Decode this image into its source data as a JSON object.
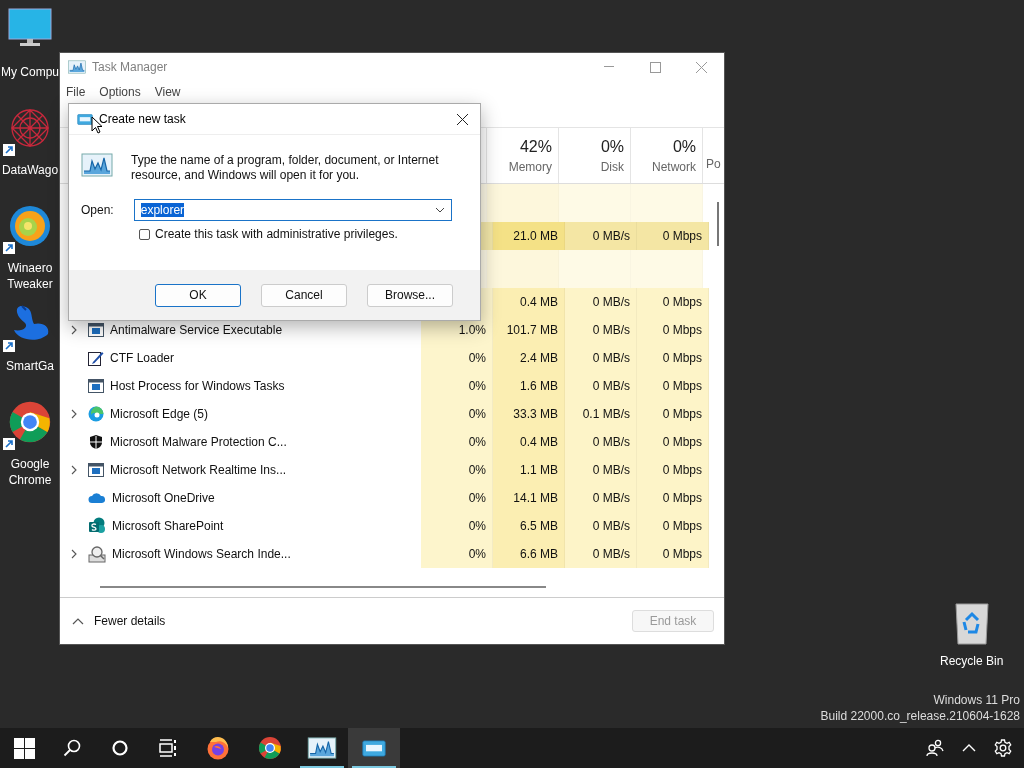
{
  "desktop": {
    "icons": [
      {
        "label": "My Compu",
        "kind": "monitor",
        "shortcut": false
      },
      {
        "label": "DataWago",
        "kind": "web",
        "shortcut": true
      },
      {
        "label": "Winaero Tweaker",
        "kind": "swirl",
        "shortcut": true
      },
      {
        "label": "SmartGa",
        "kind": "bird",
        "shortcut": true
      },
      {
        "label": "Google Chrome",
        "kind": "chrome",
        "shortcut": true
      }
    ],
    "recycle_bin": {
      "label": "Recycle Bin"
    },
    "edition": "Windows 11 Pro",
    "build": "Build 22000.co_release.210604-1628"
  },
  "task_manager": {
    "title": "Task Manager",
    "active": false,
    "menu": [
      "File",
      "Options",
      "View"
    ],
    "columns": [
      {
        "color": "#fdf5cc"
      },
      {
        "percent": "42%",
        "label": "Memory",
        "color": "#fbeeb2"
      },
      {
        "percent": "0%",
        "label": "Disk",
        "color": "#fdf4c8"
      },
      {
        "percent": "0%",
        "label": "Network",
        "color": "#fdf4c8"
      },
      {
        "label": "Po"
      }
    ],
    "rows": [
      {
        "kind": "group"
      },
      {
        "kind": "partial",
        "highlight": true,
        "memory": "21.0 MB",
        "disk": "0 MB/s",
        "network": "0 Mbps"
      },
      {
        "kind": "group"
      },
      {
        "kind": "partial",
        "highlight": false,
        "memory": "0.4 MB",
        "disk": "0 MB/s",
        "network": "0 Mbps"
      },
      {
        "kind": "app",
        "highlight": false,
        "name": "Antimalware Service Executable",
        "expandable": true,
        "cpu": "1.0%",
        "memory": "101.7 MB",
        "disk": "0 MB/s",
        "network": "0 Mbps"
      },
      {
        "kind": "pen",
        "highlight": false,
        "name": "CTF Loader",
        "expandable": false,
        "cpu": "0%",
        "memory": "2.4 MB",
        "disk": "0 MB/s",
        "network": "0 Mbps"
      },
      {
        "kind": "app",
        "highlight": false,
        "name": "Host Process for Windows Tasks",
        "expandable": false,
        "cpu": "0%",
        "memory": "1.6 MB",
        "disk": "0 MB/s",
        "network": "0 Mbps"
      },
      {
        "kind": "edge",
        "highlight": false,
        "name": "Microsoft Edge (5)",
        "expandable": true,
        "cpu": "0%",
        "memory": "33.3 MB",
        "disk": "0.1 MB/s",
        "network": "0 Mbps"
      },
      {
        "kind": "shield",
        "highlight": false,
        "name": "Microsoft Malware Protection C...",
        "expandable": false,
        "cpu": "0%",
        "memory": "0.4 MB",
        "disk": "0 MB/s",
        "network": "0 Mbps"
      },
      {
        "kind": "app",
        "highlight": false,
        "name": "Microsoft Network Realtime Ins...",
        "expandable": true,
        "cpu": "0%",
        "memory": "1.1 MB",
        "disk": "0 MB/s",
        "network": "0 Mbps"
      },
      {
        "kind": "cloud",
        "highlight": false,
        "name": "Microsoft OneDrive",
        "expandable": false,
        "cpu": "0%",
        "memory": "14.1 MB",
        "disk": "0 MB/s",
        "network": "0 Mbps"
      },
      {
        "kind": "sharepoint",
        "highlight": false,
        "name": "Microsoft SharePoint",
        "expandable": false,
        "cpu": "0%",
        "memory": "6.5 MB",
        "disk": "0 MB/s",
        "network": "0 Mbps"
      },
      {
        "kind": "indexer",
        "highlight": false,
        "name": "Microsoft Windows Search Inde...",
        "expandable": true,
        "cpu": "0%",
        "memory": "6.6 MB",
        "disk": "0 MB/s",
        "network": "0 Mbps"
      }
    ],
    "fewer_details": "Fewer details",
    "end_task": {
      "label": "End task",
      "disabled": true
    }
  },
  "dialog": {
    "title": "Create new task",
    "active": true,
    "message": "Type the name of a program, folder, document, or Internet resource, and Windows will open it for you.",
    "open_label": "Open:",
    "open_value": "explorer",
    "value_selected": true,
    "admin_checkbox": {
      "label": "Create this task with administrative privileges.",
      "checked": false
    },
    "buttons": [
      {
        "label": "OK",
        "default": true
      },
      {
        "label": "Cancel",
        "default": false
      },
      {
        "label": "Browse...",
        "default": false
      }
    ]
  },
  "taskbar": {
    "items": [
      {
        "kind": "start",
        "running": false,
        "active": false
      },
      {
        "kind": "search",
        "running": false,
        "active": false
      },
      {
        "kind": "cortana",
        "running": false,
        "active": false
      },
      {
        "kind": "taskview",
        "running": false,
        "active": false
      },
      {
        "kind": "firefox",
        "running": false,
        "active": false
      },
      {
        "kind": "chrome",
        "running": false,
        "active": false
      },
      {
        "kind": "taskmanager",
        "running": true,
        "active": false
      },
      {
        "kind": "newtask",
        "running": true,
        "active": true
      }
    ],
    "tray": [
      {
        "kind": "people"
      },
      {
        "kind": "chevron"
      },
      {
        "kind": "settings"
      }
    ]
  }
}
